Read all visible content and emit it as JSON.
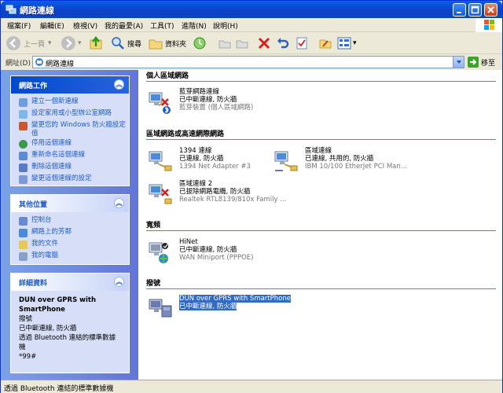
{
  "window": {
    "title": "網路連線"
  },
  "menu": [
    "檔案(F)",
    "編輯(E)",
    "檢視(V)",
    "我的最愛(A)",
    "工具(T)",
    "進階(N)",
    "說明(H)"
  ],
  "toolbar": {
    "back": "上一頁",
    "search": "搜尋",
    "folders": "資料夾"
  },
  "address": {
    "label": "網址(D)",
    "value": "網路連線",
    "go": "移至"
  },
  "tasks": {
    "title": "網路工作",
    "items": [
      "建立一個新連線",
      "設定家用或小型辦公室網路",
      "變更您的 Windows 防火牆設定值",
      "停用這個連線",
      "重新命名這個連線",
      "刪除這個連線",
      "變更這個連線的設定"
    ]
  },
  "places": {
    "title": "其他位置",
    "items": [
      "控制台",
      "網路上的芳鄰",
      "我的文件",
      "我的電腦"
    ]
  },
  "details": {
    "title": "詳細資料",
    "name": "DUN over GPRS with SmartPhone",
    "type": "撥號",
    "status": "已中斷連線, 防火牆",
    "device": "透過 Bluetooth 連結的標準數據機",
    "number": "*99#"
  },
  "groups": {
    "personal": "個人區域網路",
    "lan": "區域網路或高速網際網路",
    "broadband": "寬頻",
    "dialup": "撥號"
  },
  "connections": {
    "bt": {
      "name": "藍芽網路連線",
      "status": "已中斷連線, 防火牆",
      "device": "藍芽裝置 (個人區域網路)"
    },
    "c1394": {
      "name": "1394 連線",
      "status": "已連線, 防火牆",
      "device": "1394 Net Adapter #3"
    },
    "lan1": {
      "name": "區域連線",
      "status": "已連線, 共用的, 防火牆",
      "device": "IBM 10/100 EtherJet PCI Man..."
    },
    "lan2": {
      "name": "區域連線 2",
      "status": "已拔除網路電纜, 防火牆",
      "device": "Realtek RTL8139/810x Family ..."
    },
    "hinet": {
      "name": "HiNet",
      "status": "已中斷連線, 防火牆",
      "device": "WAN Miniport (PPPOE)"
    },
    "dun": {
      "name": "DUN over GPRS with SmartPhone",
      "status": "已中斷連線, 防火牆"
    }
  },
  "statusbar": "透過 Bluetooth 連結的標準數據機"
}
